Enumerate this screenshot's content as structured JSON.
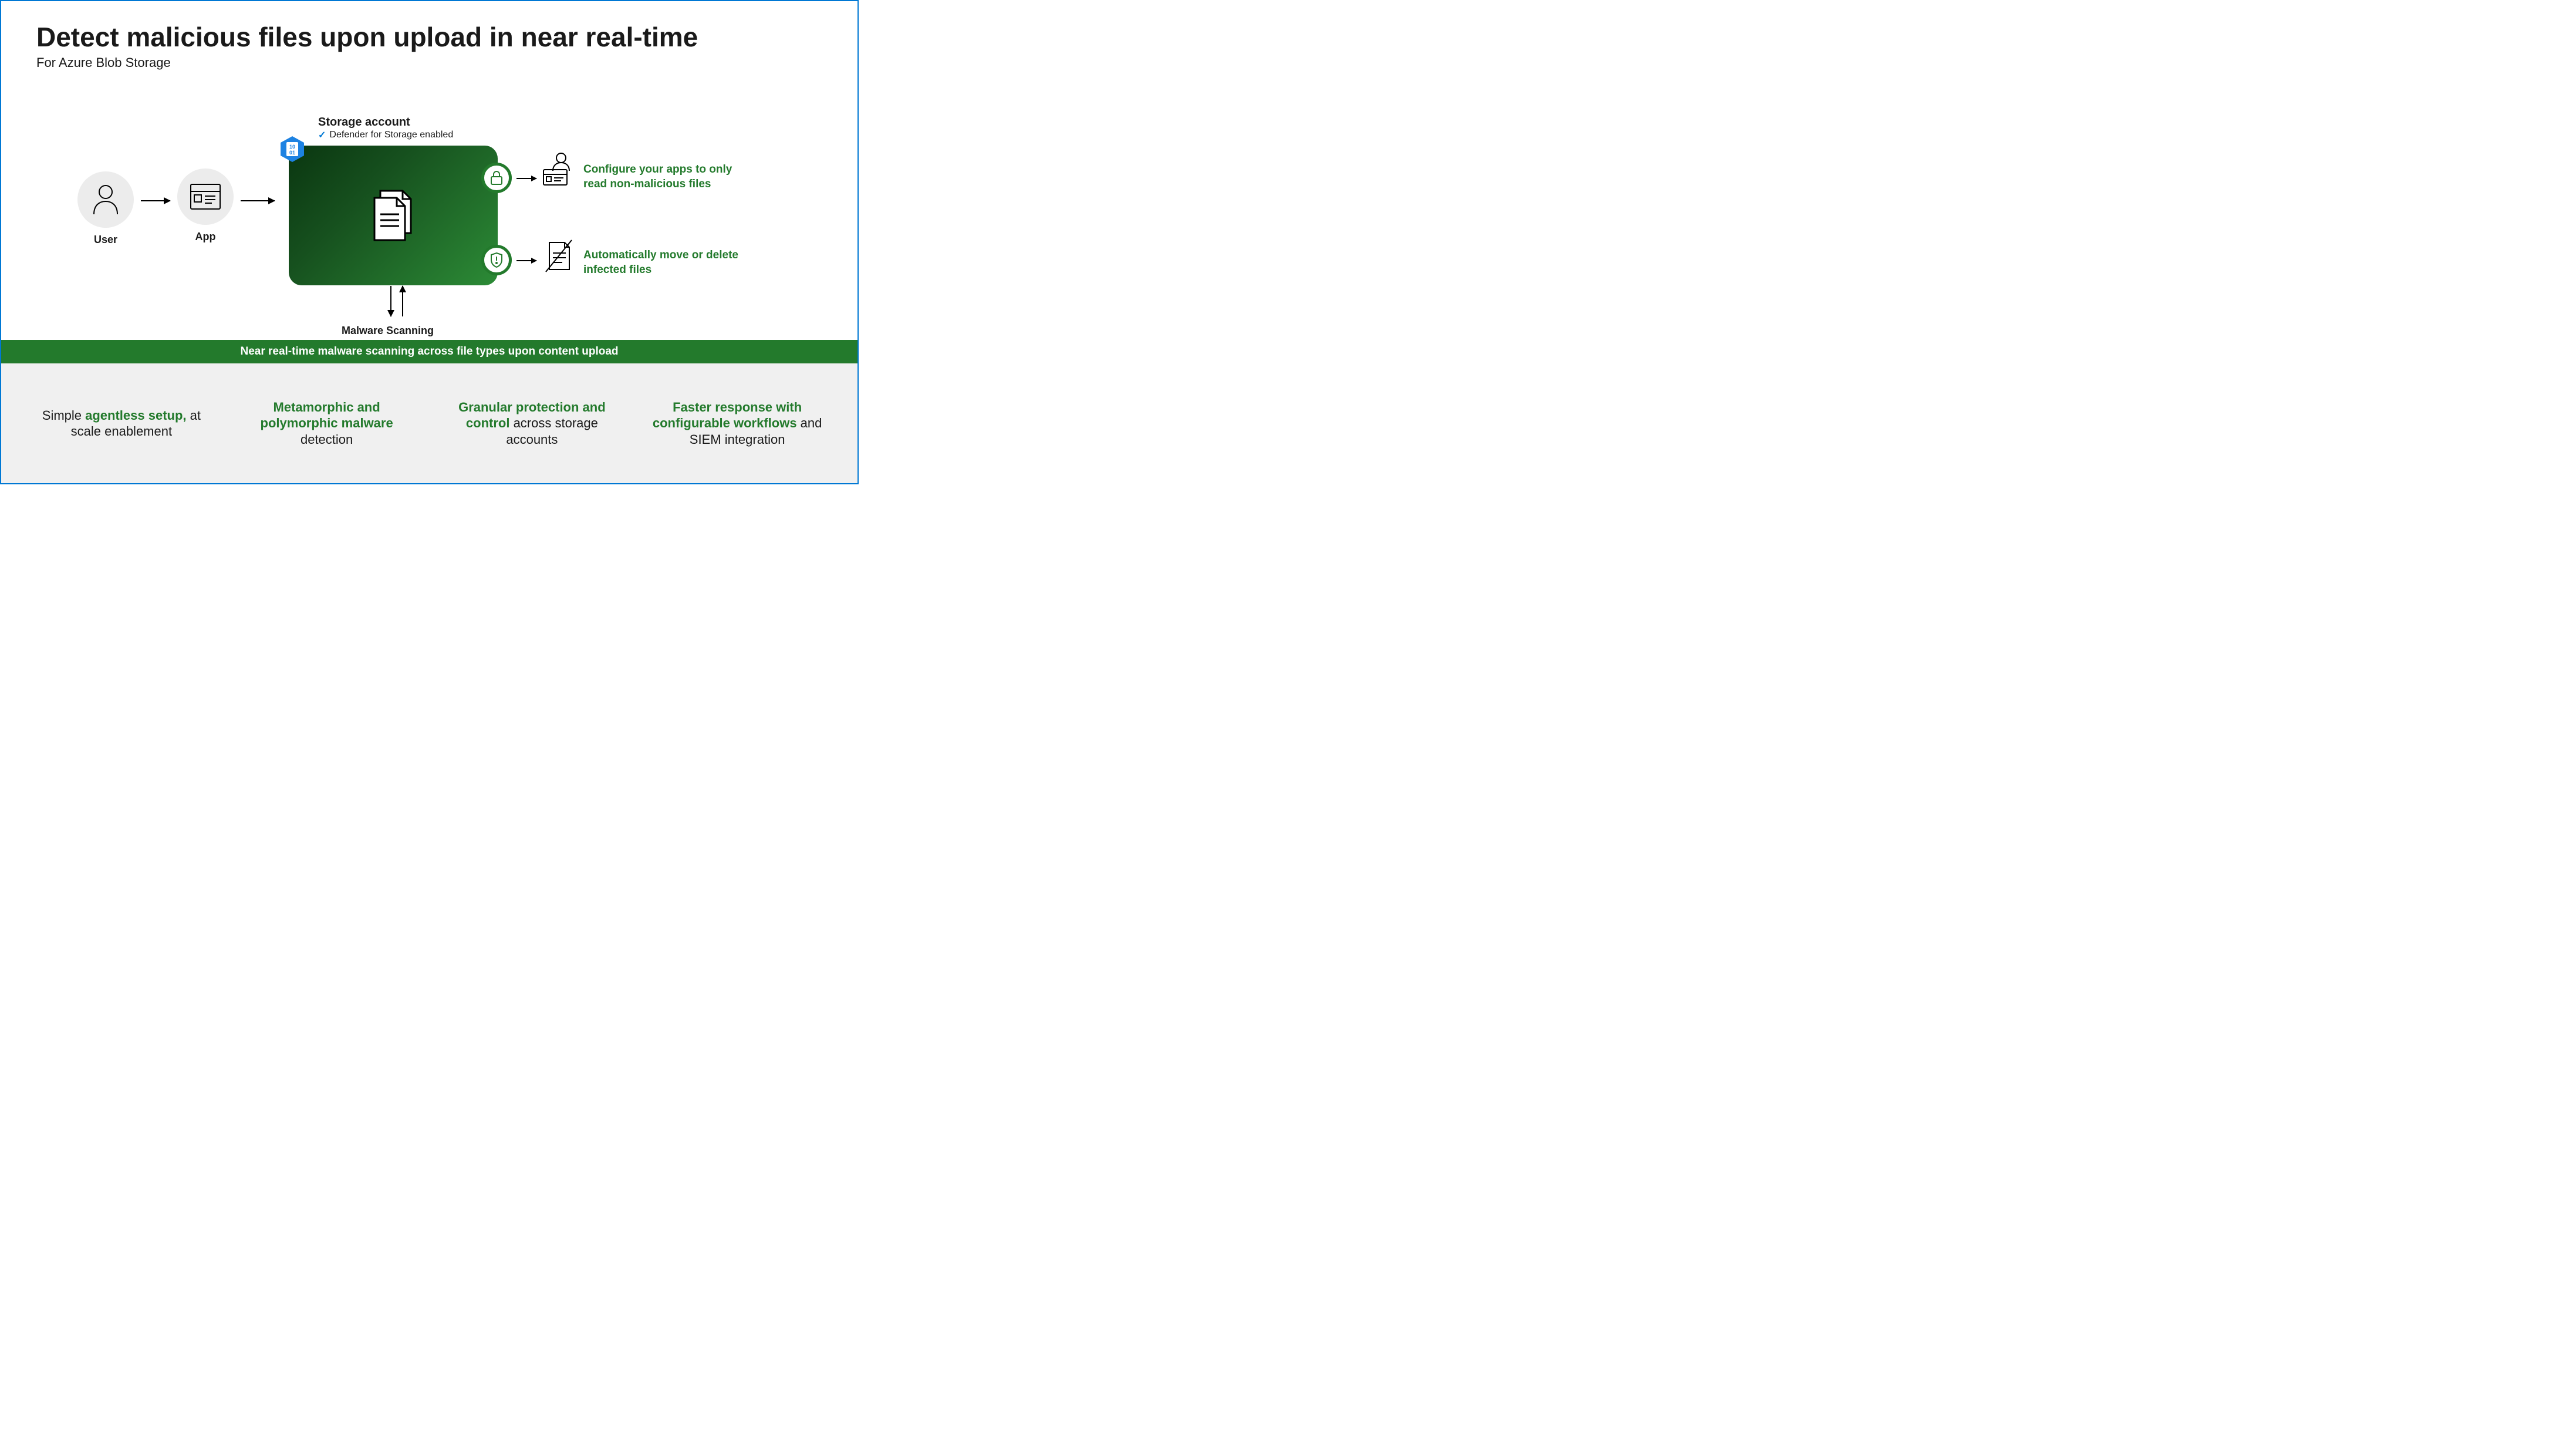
{
  "header": {
    "title_prefix": "Detect malicious files upon upload in ",
    "title_bold": "near real-time",
    "subtitle": "For Azure Blob Storage"
  },
  "flow": {
    "user_label": "User",
    "app_label": "App",
    "storage_title": "Storage account",
    "storage_status": "Defender for Storage enabled",
    "malware_label": "Malware Scanning",
    "output_lock": "Configure your apps to only read non-malicious files",
    "output_shield": "Automatically move or delete infected files"
  },
  "banner": "Near real-time malware scanning across file types upon content upload",
  "features": [
    {
      "pre": "Simple ",
      "bold": "agentless setup,",
      "post": " at scale enablement"
    },
    {
      "pre": "",
      "bold": "Metamorphic and polymorphic malware",
      "post": " detection"
    },
    {
      "pre": "",
      "bold": "Granular protection and control",
      "post": " across storage accounts"
    },
    {
      "pre": "",
      "bold": "Faster response with configurable workflows",
      "post": " and SIEM integration"
    }
  ]
}
